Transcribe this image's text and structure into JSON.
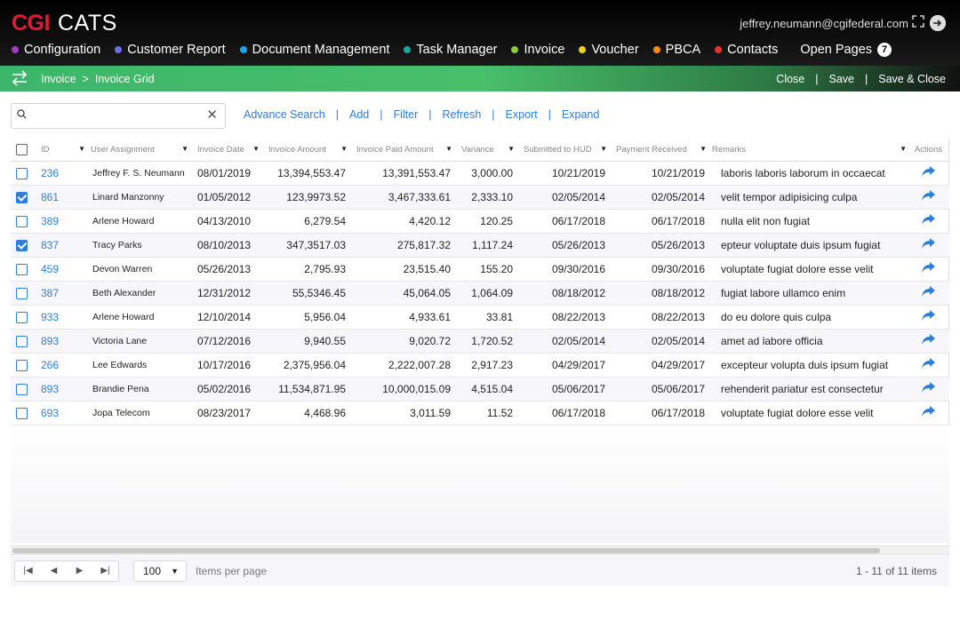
{
  "brand": {
    "logo": "CGI",
    "app": "CATS"
  },
  "user": {
    "email": "jeffrey.neumann@cgifederal.com"
  },
  "icons": {
    "expand": "expand-icon",
    "avatar": "user-avatar-icon",
    "swap": "swap-arrows-icon",
    "search": "search-icon",
    "clear": "close-icon",
    "filter": "filter-icon",
    "share": "share-arrow-icon"
  },
  "nav": [
    {
      "label": "Configuration",
      "color": "#a23dc9"
    },
    {
      "label": "Customer Report",
      "color": "#6a6ee8"
    },
    {
      "label": "Document Management",
      "color": "#1aa7ec"
    },
    {
      "label": "Task Manager",
      "color": "#16a6a0"
    },
    {
      "label": "Invoice",
      "color": "#8dc63f"
    },
    {
      "label": "Voucher",
      "color": "#f0d21b"
    },
    {
      "label": "PBCA",
      "color": "#f28c1c"
    },
    {
      "label": "Contacts",
      "color": "#e8322e"
    }
  ],
  "open_pages": {
    "label": "Open Pages",
    "count": "7"
  },
  "breadcrumb": {
    "items": [
      "Invoice",
      "Invoice Grid"
    ],
    "sep": ">"
  },
  "actions": {
    "close": "Close",
    "save": "Save",
    "save_close": "Save & Close",
    "sep": "|"
  },
  "search": {
    "placeholder": "",
    "value": ""
  },
  "toolbar": {
    "advance_search": "Advance Search",
    "add": "Add",
    "filter": "Filter",
    "refresh": "Refresh",
    "export": "Export",
    "expand": "Expand",
    "sep": "|"
  },
  "grid": {
    "columns": [
      "ID",
      "User Assignment",
      "Invoice Date",
      "Invoice Amount",
      "Invoice Paid Amount",
      "Variance",
      "Submitted to HUD",
      "Payment Received",
      "Remarks",
      "Actions"
    ],
    "rows": [
      {
        "checked": false,
        "id": "236",
        "user": "Jeffrey F. S. Neumann",
        "date": "08/01/2019",
        "amount": "13,394,553.47",
        "paid": "13,391,553.47",
        "variance": "3,000.00",
        "submitted": "10/21/2019",
        "received": "10/21/2019",
        "remarks": "laboris laboris laborum in occaecat"
      },
      {
        "checked": true,
        "id": "861",
        "user": "Linard Manzonny",
        "date": "01/05/2012",
        "amount": "123,9973.52",
        "paid": "3,467,333.61",
        "variance": "2,333.10",
        "submitted": "02/05/2014",
        "received": "02/05/2014",
        "remarks": "velit tempor adipisicing culpa"
      },
      {
        "checked": false,
        "id": "389",
        "user": "Arlene Howard",
        "date": "04/13/2010",
        "amount": "6,279.54",
        "paid": "4,420.12",
        "variance": "120.25",
        "submitted": "06/17/2018",
        "received": "06/17/2018",
        "remarks": "nulla elit non fugiat"
      },
      {
        "checked": true,
        "id": "837",
        "user": "Tracy Parks",
        "date": "08/10/2013",
        "amount": "347,3517.03",
        "paid": "275,817.32",
        "variance": "1,117.24",
        "submitted": "05/26/2013",
        "received": "05/26/2013",
        "remarks": "epteur voluptate duis ipsum fugiat"
      },
      {
        "checked": false,
        "id": "459",
        "user": "Devon Warren",
        "date": "05/26/2013",
        "amount": "2,795.93",
        "paid": "23,515.40",
        "variance": "155.20",
        "submitted": "09/30/2016",
        "received": "09/30/2016",
        "remarks": "voluptate fugiat dolore esse velit"
      },
      {
        "checked": false,
        "id": "387",
        "user": "Beth Alexander",
        "date": "12/31/2012",
        "amount": "55,5346.45",
        "paid": "45,064.05",
        "variance": "1,064.09",
        "submitted": "08/18/2012",
        "received": "08/18/2012",
        "remarks": "fugiat labore ullamco enim"
      },
      {
        "checked": false,
        "id": "933",
        "user": "Arlene Howard",
        "date": "12/10/2014",
        "amount": "5,956.04",
        "paid": "4,933.61",
        "variance": "33.81",
        "submitted": "08/22/2013",
        "received": "08/22/2013",
        "remarks": "do eu dolore quis culpa"
      },
      {
        "checked": false,
        "id": "893",
        "user": "Victoria Lane",
        "date": "07/12/2016",
        "amount": "9,940.55",
        "paid": "9,020.72",
        "variance": "1,720.52",
        "submitted": "02/05/2014",
        "received": "02/05/2014",
        "remarks": "amet ad labore officia"
      },
      {
        "checked": false,
        "id": "266",
        "user": "Lee Edwards",
        "date": "10/17/2016",
        "amount": "2,375,956.04",
        "paid": "2,222,007.28",
        "variance": "2,917.23",
        "submitted": "04/29/2017",
        "received": "04/29/2017",
        "remarks": "excepteur volupta duis ipsum fugiat"
      },
      {
        "checked": false,
        "id": "893",
        "user": "Brandie Pena",
        "date": "05/02/2016",
        "amount": "11,534,871.95",
        "paid": "10,000,015.09",
        "variance": "4,515.04",
        "submitted": "05/06/2017",
        "received": "05/06/2017",
        "remarks": "rehenderit pariatur est consectetur"
      },
      {
        "checked": false,
        "id": "693",
        "user": "Jopa Telecom",
        "date": "08/23/2017",
        "amount": "4,468.96",
        "paid": "3,011.59",
        "variance": "11.52",
        "submitted": "06/17/2018",
        "received": "06/17/2018",
        "remarks": "voluptate fugiat dolore esse velit"
      }
    ]
  },
  "pager": {
    "page_size": "100",
    "items_label": "Items per page",
    "info": "1 - 11 of 11 items"
  },
  "colors": {
    "accent": "#2f7ed8",
    "brand_red": "#e31937",
    "green": "#3cb66a"
  }
}
